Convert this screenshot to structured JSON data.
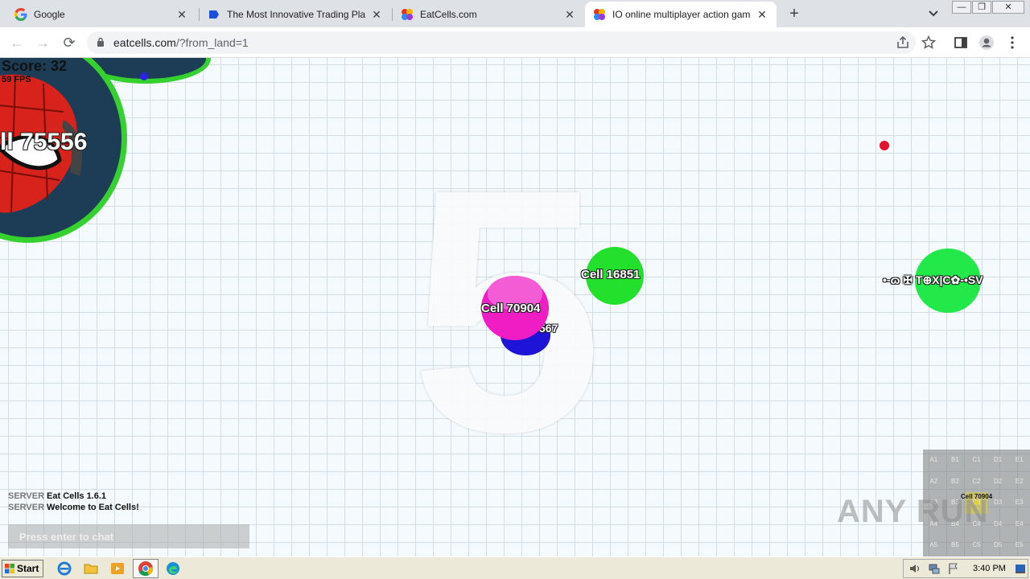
{
  "browser": {
    "tabs": [
      {
        "title": "Google",
        "active": false
      },
      {
        "title": "The Most Innovative Trading Platform",
        "active": false
      },
      {
        "title": "EatCells.com",
        "active": false
      },
      {
        "title": "IO online multiplayer action game. Stay",
        "active": true
      }
    ],
    "url_host": "eatcells.com",
    "url_path": "/?from_land=1",
    "window_controls": {
      "minimize": "—",
      "restore": "❐",
      "close": "✕"
    }
  },
  "game": {
    "score": "Score: 32",
    "fps": "59 FPS",
    "countdown": "5",
    "cells": [
      {
        "label": "ll 75556",
        "color": "#1d3d57",
        "border": "#35d12e"
      },
      {
        "label": "Cell 16851",
        "color": "#22e02b"
      },
      {
        "label": "Cell 70904",
        "color": "#f01cc4"
      },
      {
        "label": "567",
        "color": "#1d14d8"
      },
      {
        "label": "•-ɷ ✠ T⊕X|C✿-•SV",
        "color": "#22e84a"
      }
    ],
    "food": [
      {
        "color": "#2b22e8"
      },
      {
        "color": "#e8112b"
      }
    ],
    "chat": {
      "messages": [
        {
          "sender": "SERVER",
          "text": "Eat Cells 1.6.1"
        },
        {
          "sender": "SERVER",
          "text": "Welcome to Eat Cells!"
        }
      ],
      "placeholder": "Press enter to chat"
    },
    "minimap": {
      "rows": [
        [
          "A1",
          "B1",
          "C1",
          "D1",
          "E1"
        ],
        [
          "A2",
          "B2",
          "C2",
          "D2",
          "E2"
        ],
        [
          "A3",
          "B3",
          "C3",
          "D3",
          "E3"
        ],
        [
          "A4",
          "B4",
          "C4",
          "D4",
          "E4"
        ],
        [
          "A5",
          "B5",
          "C5",
          "D5",
          "E5"
        ]
      ],
      "player_label": "Cell 70904",
      "player_sector": "C3"
    },
    "watermark": "ANY RUN"
  },
  "taskbar": {
    "start_label": "Start",
    "clock": "3:40 PM"
  }
}
